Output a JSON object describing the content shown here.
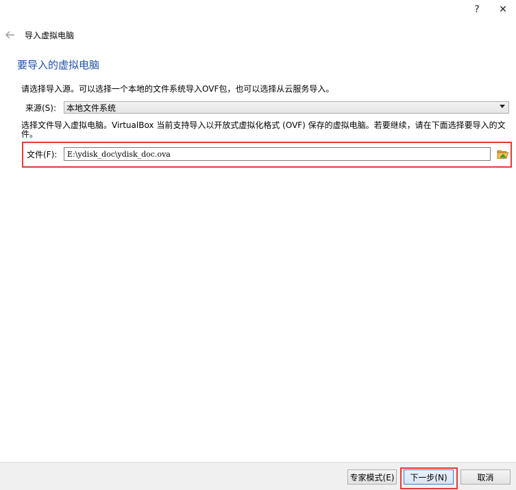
{
  "window": {
    "help_label": "?",
    "close_label": "✕"
  },
  "header": {
    "wizard_title": "导入虚拟电脑"
  },
  "page": {
    "heading": "要导入的虚拟电脑",
    "description_source": "请选择导入源。可以选择一个本地的文件系统导入OVF包，也可以选择从云服务导入。",
    "source_label": "来源(S):",
    "source_value": "本地文件系统",
    "description_file": "选择文件导入虚拟电脑。VirtualBox 当前支持导入以开放式虚拟化格式 (OVF) 保存的虚拟电脑。若要继续，请在下面选择要导入的文件。",
    "file_label": "文件(F):",
    "file_value": "E:\\ydisk_doc\\ydisk_doc.ova"
  },
  "footer": {
    "expert_label": "专家模式(E)",
    "next_label": "下一步(N)",
    "cancel_label": "取消"
  },
  "colors": {
    "heading": "#1f4fa8",
    "highlight": "#e53935"
  },
  "icons": {
    "back": "arrow-left-icon",
    "folder": "folder-open-icon"
  }
}
